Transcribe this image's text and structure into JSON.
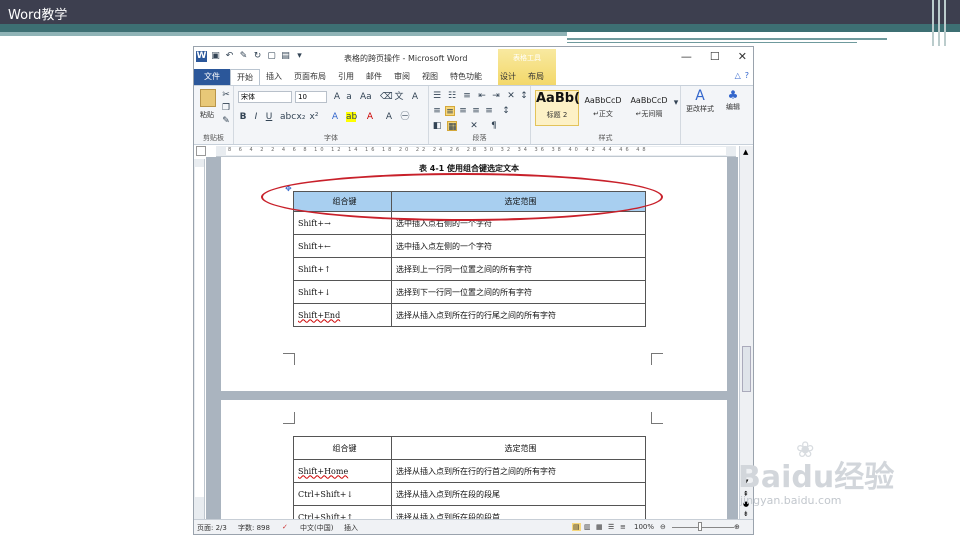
{
  "slide": {
    "title": "Word教学"
  },
  "window": {
    "title": "表格的跨页操作 - Microsoft Word",
    "contextual_tab": "表格工具",
    "controls": {
      "minimize": "—",
      "maximize": "☐",
      "close": "✕"
    }
  },
  "tabs": [
    "文件",
    "开始",
    "插入",
    "页面布局",
    "引用",
    "邮件",
    "审阅",
    "视图",
    "特色功能",
    "设计",
    "布局"
  ],
  "ribbon": {
    "clipboard": {
      "label": "剪贴板",
      "paste": "粘贴"
    },
    "font": {
      "label": "字体",
      "font_name": "宋体",
      "font_size": "10"
    },
    "paragraph": {
      "label": "段落"
    },
    "styles": {
      "label": "样式",
      "items": [
        {
          "preview": "AaBb(",
          "name": "标题 2"
        },
        {
          "preview": "AaBbCcD",
          "name": "↵正文"
        },
        {
          "preview": "AaBbCcD",
          "name": "↵无间隔"
        }
      ],
      "change_styles": "更改样式",
      "editing": "编辑"
    }
  },
  "ruler_numbers": "8 6 4 2 2 4 6 8 10 12 14 16 18 20 22 24 26 28 30 32 34 36 38 40 42 44 46 48",
  "document": {
    "caption": "表 4-1  使用组合键选定文本",
    "table1": {
      "headers": [
        "组合键",
        "选定范围"
      ],
      "rows": [
        [
          "Shift+→",
          "选中插入点右侧的一个字符"
        ],
        [
          "Shift+←",
          "选中插入点左侧的一个字符"
        ],
        [
          "Shift+↑",
          "选择到上一行同一位置之间的所有字符"
        ],
        [
          "Shift+↓",
          "选择到下一行同一位置之间的所有字符"
        ],
        [
          "Shift+End",
          "选择从插入点到所在行的行尾之间的所有字符"
        ]
      ]
    },
    "table2": {
      "headers": [
        "组合键",
        "选定范围"
      ],
      "rows": [
        [
          "Shift+Home",
          "选择从插入点到所在行的行首之间的所有字符"
        ],
        [
          "Ctrl+Shift+↓",
          "选择从插入点到所在段的段尾"
        ],
        [
          "Ctrl+Shift+↑",
          "选择从插入点到所在段的段首"
        ]
      ]
    }
  },
  "status": {
    "page": "页面: 2/3",
    "words": "字数: 898",
    "language": "中文(中国)",
    "mode": "插入",
    "zoom": "100%"
  },
  "watermark": {
    "brand": "Baidu经验",
    "url": "jingyan.baidu.com"
  },
  "colors": {
    "word_blue": "#2b579a",
    "header_fill": "#a8cff0",
    "highlight_ellipse": "#c8202a"
  }
}
